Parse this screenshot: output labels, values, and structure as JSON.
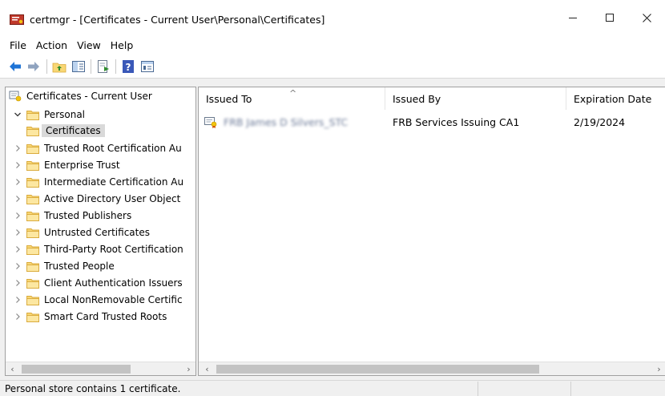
{
  "window": {
    "title": "certmgr - [Certificates - Current User\\Personal\\Certificates]",
    "minimize_symbol": "—",
    "maximize_symbol": "☐",
    "close_symbol": "✕"
  },
  "menu": {
    "items": [
      "File",
      "Action",
      "View",
      "Help"
    ]
  },
  "toolbar": {
    "buttons": [
      "back-arrow-icon",
      "forward-arrow-icon",
      "up-folder-icon",
      "show-hide-tree-icon",
      "export-list-icon",
      "help-icon",
      "properties-icon"
    ]
  },
  "tree": {
    "root": "Certificates - Current User",
    "items": [
      {
        "label": "Personal",
        "expanded": true
      },
      {
        "label": "Certificates",
        "selected": true
      },
      {
        "label": "Trusted Root Certification Au"
      },
      {
        "label": "Enterprise Trust"
      },
      {
        "label": "Intermediate Certification Au"
      },
      {
        "label": "Active Directory User Object"
      },
      {
        "label": "Trusted Publishers"
      },
      {
        "label": "Untrusted Certificates"
      },
      {
        "label": "Third-Party Root Certification"
      },
      {
        "label": "Trusted People"
      },
      {
        "label": "Client Authentication Issuers"
      },
      {
        "label": "Local NonRemovable Certific"
      },
      {
        "label": "Smart Card Trusted Roots"
      }
    ]
  },
  "list": {
    "columns": [
      "Issued To",
      "Issued By",
      "Expiration Date"
    ],
    "sort_indicator": "^",
    "rows": [
      {
        "issued_to": "FRB James D Silvers_STC",
        "issued_by": "FRB Services Issuing CA1",
        "expiration": "2/19/2024"
      }
    ]
  },
  "status": {
    "text": "Personal store contains 1 certificate."
  },
  "colors": {
    "selection": "#d9d9d9",
    "folder_fill": "#f8d775",
    "folder_edge": "#d9a93a",
    "nav_arrow": "#1f74d6"
  }
}
